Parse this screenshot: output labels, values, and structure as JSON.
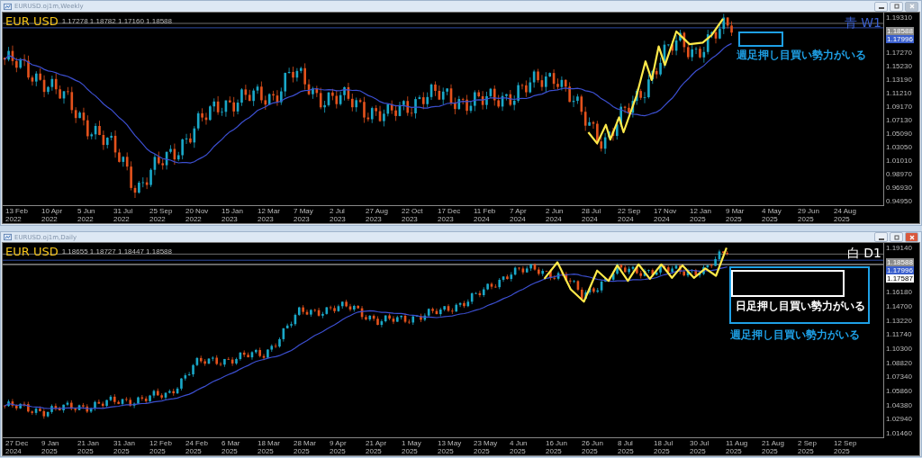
{
  "windows": [
    {
      "title": "EURUSD.oj1m,Weekly",
      "active": false,
      "symbol": "EUR USD",
      "ohlc": "1.17278 1.18782 1.17160 1.18588",
      "timeframe_label": "青 W1",
      "price_labels": [
        "1.19310",
        "1.17270",
        "1.15230",
        "1.13190",
        "1.11210",
        "1.09170",
        "1.07130",
        "1.05090",
        "1.03050",
        "1.01010",
        "0.98970",
        "0.96930",
        "0.94950"
      ],
      "price_tags": [
        {
          "value": "1.18588",
          "color": "#8c8c8c"
        },
        {
          "value": "1.17996",
          "color": "#3a5fcd"
        }
      ],
      "time_labels": [
        "13 Feb 2022",
        "10 Apr 2022",
        "5 Jun 2022",
        "31 Jul 2022",
        "25 Sep 2022",
        "20 Nov 2022",
        "15 Jan 2023",
        "12 Mar 2023",
        "7 May 2023",
        "2 Jul 2023",
        "27 Aug 2023",
        "22 Oct 2023",
        "17 Dec 2023",
        "11 Feb 2024",
        "7 Apr 2024",
        "2 Jun 2024",
        "28 Jul 2024",
        "22 Sep 2024",
        "17 Nov 2024",
        "12 Jan 2025",
        "9 Mar 2025",
        "4 May 2025",
        "29 Jun 2025",
        "24 Aug 2025"
      ],
      "notes": [
        {
          "text": "週足押し目買い勢力がいる",
          "color": "#1ea0e6"
        }
      ]
    },
    {
      "title": "EURUSD.oj1m,Daily",
      "active": true,
      "symbol": "EUR USD",
      "ohlc": "1.18655 1.18727 1.18447 1.18588",
      "timeframe_label": "白 D1",
      "price_labels": [
        "1.19140",
        "1.16180",
        "1.14700",
        "1.13220",
        "1.11740",
        "1.10300",
        "1.08820",
        "1.07340",
        "1.05860",
        "1.04380",
        "1.02940",
        "1.01460"
      ],
      "price_tags": [
        {
          "value": "1.18588",
          "color": "#8c8c8c"
        },
        {
          "value": "1.17996",
          "color": "#3a5fcd"
        },
        {
          "value": "1.17587",
          "color": "#ffffff"
        }
      ],
      "time_labels": [
        "27 Dec 2024",
        "9 Jan 2025",
        "21 Jan 2025",
        "31 Jan 2025",
        "12 Feb 2025",
        "24 Feb 2025",
        "6 Mar 2025",
        "18 Mar 2025",
        "28 Mar 2025",
        "9 Apr 2025",
        "21 Apr 2025",
        "1 May 2025",
        "13 May 2025",
        "23 May 2025",
        "4 Jun 2025",
        "16 Jun 2025",
        "26 Jun 2025",
        "8 Jul 2025",
        "18 Jul 2025",
        "30 Jul 2025",
        "11 Aug 2025",
        "21 Aug 2025",
        "2 Sep 2025",
        "12 Sep 2025"
      ],
      "notes": [
        {
          "text": "日足押し目買い勢力がいる",
          "color": "#ffffff"
        },
        {
          "text": "週足押し目買い勢力がいる",
          "color": "#1ea0e6"
        }
      ]
    }
  ]
}
